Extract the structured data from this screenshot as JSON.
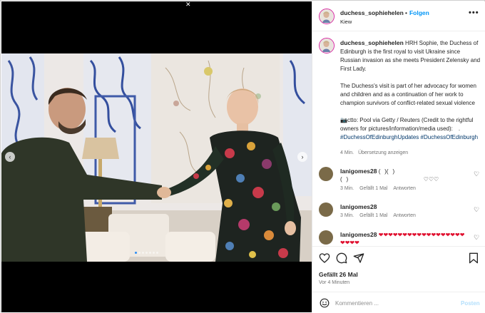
{
  "media": {
    "close_glyph": "✕",
    "prev_glyph": "‹",
    "next_glyph": "›",
    "carousel": {
      "count": 7,
      "active_index": 0
    }
  },
  "header": {
    "username": "duchess_sophiehelen",
    "separator": "•",
    "follow_label": "Folgen",
    "location": "Kiew",
    "more_glyph": "•••"
  },
  "caption": {
    "username": "duchess_sophiehelen",
    "text_1": "HRH Sophie, the Duchess of Edinburgh is the first royal to visit Ukraine since Russian invasion as she meets President Zelensky and First Lady.",
    "text_2": "The Duchess's visit is part of her advocacy for women and children and as a continuation of her work to champion survivors of conflict-related sexual violence",
    "text_3_prefix": "📷ctto: Pool via Getty / Reuters (Credit to the rightful owners for pictures/information/media used): ⠀. ",
    "hashtag_1": "#DuchessOfEdinburghUpdates",
    "hashtag_2": "#DuchessOfEdinburgh",
    "age": "4 Min.",
    "translate_label": "Übersetzung anzeigen"
  },
  "comments": [
    {
      "username": "lanigomes28",
      "text": "(⠀)(⠀)(⠀)⠀⠀⠀⠀⠀⠀⠀⠀⠀⠀⠀⠀⠀⠀⠀⠀⠀⠀♡♡♡",
      "time": "3 Min.",
      "likes": "Gefällt 1 Mal",
      "reply": "Antworten"
    },
    {
      "username": "lanigomes28",
      "text": "⠀⠀⠀⠀⠀⠀⠀⠀⠀⠀⠀⠀⠀⠀⠀⠀⠀⠀⠀⠀⠀⠀⠀",
      "time": "3 Min.",
      "likes": "Gefällt 1 Mal",
      "reply": "Antworten"
    },
    {
      "username": "lanigomes28",
      "text": "❤❤❤❤❤❤❤❤❤❤❤❤❤❤❤❤❤❤❤❤❤❤"
    }
  ],
  "actions": {
    "like_count": "Gefällt 26 Mal",
    "posted_time": "Vor 4 Minuten"
  },
  "comment_box": {
    "placeholder": "Kommentieren ...",
    "post_label": "Posten"
  },
  "icons": {
    "like": "heart-icon",
    "comment": "comment-icon",
    "share": "share-icon",
    "save": "bookmark-icon",
    "emoji": "smiley-icon"
  },
  "colors": {
    "link": "#0095f6",
    "hashtag": "#00376b",
    "muted": "#737373",
    "heart_red": "#e0102f",
    "post_disabled": "#b2dffc"
  }
}
